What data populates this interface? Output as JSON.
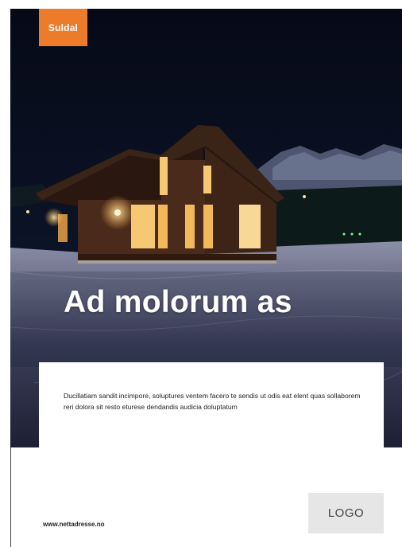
{
  "brand": {
    "badge_text": "Suldal",
    "badge_color": "#ec7b2a"
  },
  "hero": {
    "image_subject": "wooden-cabin-night-snow-photo",
    "headline": "Ad molorum as"
  },
  "body": {
    "paragraph": "Ducillatiam sandit incimpore, soluptures ventem facero te sendis ut odis eat elent quas sollaborem reri dolora sit resto eturese dendandis audicia doluptatum"
  },
  "footer": {
    "website": "www.nettadresse.no",
    "logo_placeholder": "LOGO"
  }
}
